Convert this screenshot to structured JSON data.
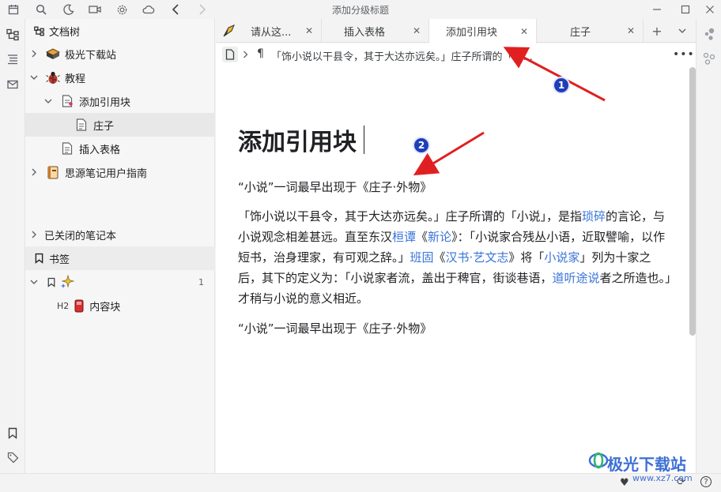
{
  "window": {
    "title": "添加分级标题"
  },
  "sidebar": {
    "header": "文档树",
    "tree": [
      {
        "label": "极光下载站"
      },
      {
        "label": "教程"
      },
      {
        "label": "添加引用块"
      },
      {
        "label": "庄子"
      },
      {
        "label": "插入表格"
      },
      {
        "label": "思源笔记用户指南"
      }
    ],
    "closed_notebooks": "已关闭的笔记本",
    "bookmarks": {
      "label": "书签",
      "group_count": "1",
      "heading_tag": "H2",
      "item": "内容块"
    }
  },
  "tabs": [
    {
      "label": "请从这..."
    },
    {
      "label": "插入表格"
    },
    {
      "label": "添加引用块"
    },
    {
      "label": "庄子"
    }
  ],
  "breadcrumb": {
    "text": "「饰小说以干县令，其于大达亦远矣。」庄子所谓的「小..."
  },
  "document": {
    "title": "添加引用块",
    "para1": "“小说”一词最早出现于《庄子·外物》",
    "para2": {
      "p1": "「饰小说以干县令，其于大达亦远矣。」庄子所谓的「小说」，是指",
      "l1": "琐碎",
      "p2": "的言论，与小说观念相差甚远。直至东汉",
      "l2": "桓谭",
      "p3": "《",
      "l3": "新论",
      "p4": "》：「小说家合残丛小语，近取譬喻，以作短书，治身理家，有可观之辞。」",
      "l4": "班固",
      "p5": "《",
      "l5": "汉书·艺文志",
      "p6": "》将「",
      "l6": "小说家",
      "p7": "」列为十家之后，其下的定义为：「小说家者流，盖出于稗官，街谈巷语，",
      "l7": "道听途说",
      "p8": "者之所造也。」才稍与小说的意义相近。"
    },
    "para3": "“小说”一词最早出现于《庄子·外物》"
  },
  "annotations": {
    "badge1": "1",
    "badge2": "2"
  },
  "watermark": {
    "text": "极光下载站",
    "url": "www.xz7.com"
  },
  "colors": {
    "accent_link": "#3874d8",
    "arrow_red": "#e02020",
    "badge_blue": "#1e3fb8"
  }
}
